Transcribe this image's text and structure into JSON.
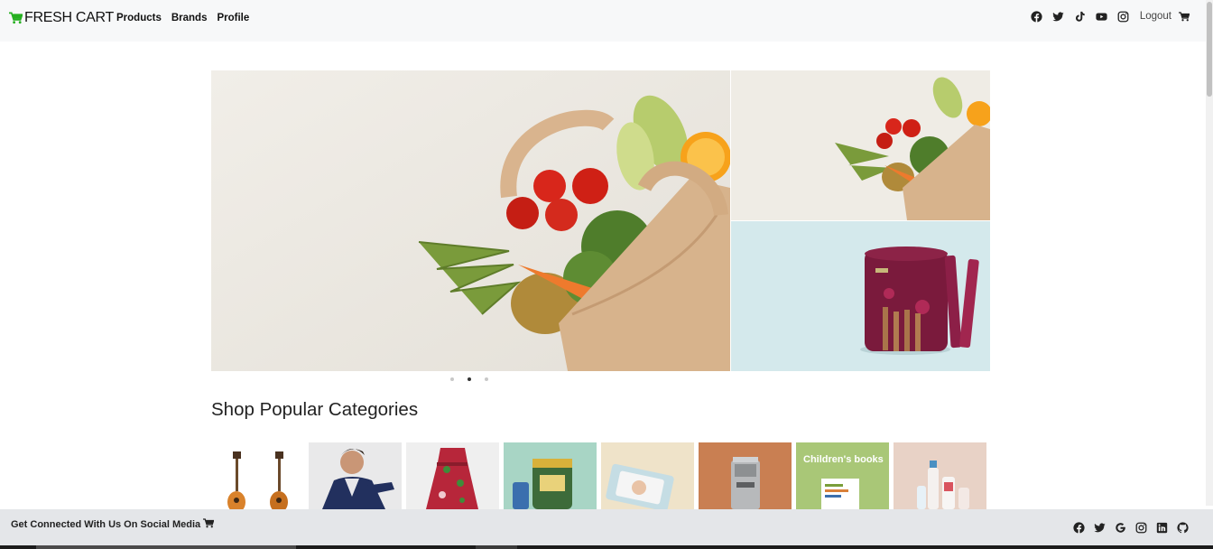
{
  "navbar": {
    "brand": "FRESH CART",
    "links": [
      "Products",
      "Brands",
      "Profile"
    ],
    "social_icons": [
      "facebook-icon",
      "twitter-icon",
      "tiktok-icon",
      "youtube-icon",
      "instagram-icon"
    ],
    "logout_label": "Logout",
    "cart_icon": "shopping-cart-icon"
  },
  "colors": {
    "brand_green": "#26b021",
    "navbar_bg": "#f7f8f9",
    "footer_bg": "#e4e6e9"
  },
  "slider": {
    "slides": [
      "grocery-bag-vegetables",
      "grocery-bag-vegetables",
      "red-velvet-wafer-rolls"
    ],
    "dot_count": 3,
    "active_dot": 2
  },
  "categories": {
    "title": "Shop Popular Categories",
    "items": [
      {
        "image": "guitars"
      },
      {
        "image": "man-in-hoodie"
      },
      {
        "image": "floral-dress"
      },
      {
        "image": "formula-can"
      },
      {
        "image": "baby-diapers"
      },
      {
        "image": "espresso-machine"
      },
      {
        "image": "childrens-books",
        "label": "Children's books"
      },
      {
        "image": "skincare-bottles"
      }
    ]
  },
  "footer": {
    "text": "Get Connected With Us On Social Media",
    "social_icons": [
      "facebook-icon",
      "twitter-icon",
      "google-icon",
      "instagram-icon",
      "linkedin-icon",
      "github-icon"
    ]
  }
}
